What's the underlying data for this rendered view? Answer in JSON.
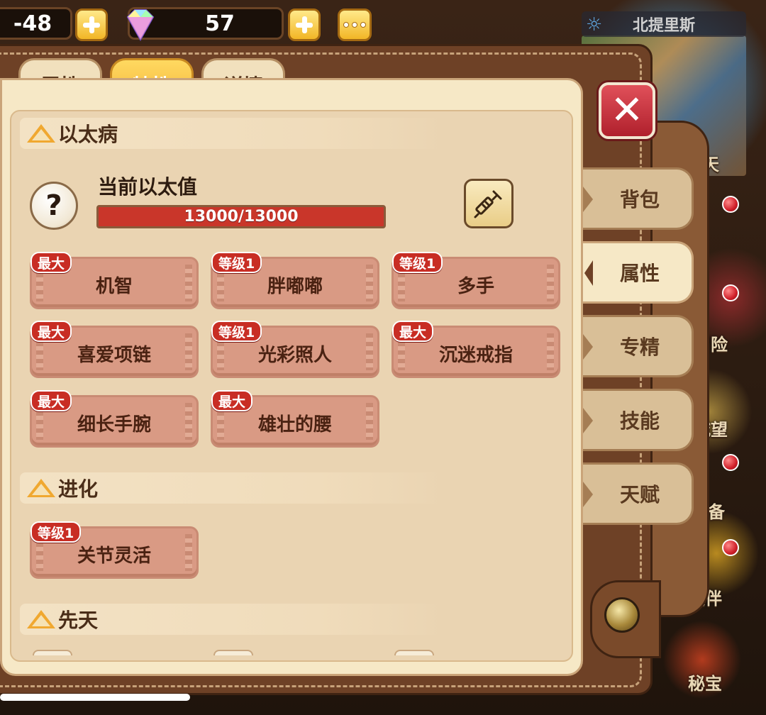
{
  "currency": {
    "coins_value": "48",
    "coins_prefix": "-",
    "gems_value": "57"
  },
  "minimap": {
    "title": "北提里斯",
    "corner_text": "白天"
  },
  "side_menu": [
    {
      "label": "冒险"
    },
    {
      "label": "城望"
    },
    {
      "label": "备"
    },
    {
      "label": "伙伴"
    },
    {
      "label": "秘宝"
    }
  ],
  "top_tabs": [
    {
      "label": "属性",
      "active": false
    },
    {
      "label": "特性",
      "active": true
    },
    {
      "label": "详情",
      "active": false
    }
  ],
  "right_tabs": [
    {
      "label": "背包",
      "active": false
    },
    {
      "label": "属性",
      "active": true
    },
    {
      "label": "专精",
      "active": false
    },
    {
      "label": "技能",
      "active": false
    },
    {
      "label": "天赋",
      "active": false
    }
  ],
  "sections": {
    "ether": {
      "title": "以太病",
      "current_label": "当前以太值",
      "bar_text": "13000/13000",
      "fill_fraction": 1.0,
      "traits": [
        {
          "badge": "最大",
          "name": "机智"
        },
        {
          "badge": "等级1",
          "name": "胖嘟嘟"
        },
        {
          "badge": "等级1",
          "name": "多手"
        },
        {
          "badge": "最大",
          "name": "喜爱项链"
        },
        {
          "badge": "等级1",
          "name": "光彩照人"
        },
        {
          "badge": "最大",
          "name": "沉迷戒指"
        },
        {
          "badge": "最大",
          "name": "细长手腕"
        },
        {
          "badge": "最大",
          "name": "雄壮的腰"
        }
      ]
    },
    "evolution": {
      "title": "进化",
      "traits": [
        {
          "badge": "等级1",
          "name": "关节灵活"
        }
      ]
    },
    "innate": {
      "title": "先天"
    }
  },
  "colors": {
    "accent_gold": "#f2b13a",
    "badge_red": "#c82d24",
    "bar_red": "#c9362a",
    "trait_card": "#d99a84"
  },
  "icons": [
    "plus-icon",
    "gem-icon",
    "more-icon",
    "sun-icon",
    "close-icon",
    "help-icon",
    "syringe-icon",
    "collapse-triangle-icon"
  ]
}
